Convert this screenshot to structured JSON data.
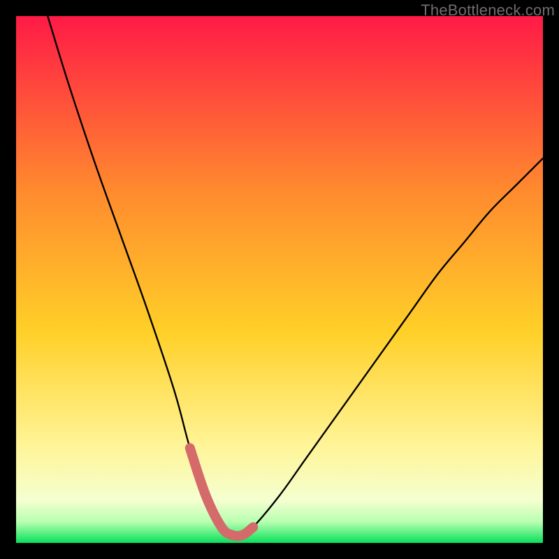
{
  "watermark": "TheBottleneck.com",
  "colors": {
    "bg_black": "#000000",
    "grad_top": "#ff1a46",
    "grad_mid1": "#ff6a2e",
    "grad_mid2": "#ffd028",
    "grad_low": "#fff59a",
    "grad_pale": "#f7ffd6",
    "grad_bottom": "#08e05a",
    "curve": "#000000",
    "highlight": "#d56a6a"
  },
  "chart_data": {
    "type": "line",
    "title": "",
    "xlabel": "",
    "ylabel": "",
    "xlim": [
      0,
      100
    ],
    "ylim": [
      0,
      100
    ],
    "series": [
      {
        "name": "bottleneck-curve",
        "x": [
          6,
          10,
          15,
          20,
          25,
          30,
          33,
          36,
          39,
          41,
          43,
          45,
          50,
          55,
          60,
          65,
          70,
          75,
          80,
          85,
          90,
          95,
          100
        ],
        "y": [
          100,
          87,
          72,
          58,
          44,
          29,
          18,
          9,
          3,
          1.5,
          1.5,
          3,
          9,
          16,
          23,
          30,
          37,
          44,
          51,
          57,
          63,
          68,
          73
        ]
      },
      {
        "name": "optimal-range-highlight",
        "x": [
          33,
          36,
          39,
          41,
          43,
          45
        ],
        "y": [
          18,
          9,
          3,
          1.5,
          1.5,
          3
        ]
      }
    ],
    "gradient_bands": [
      {
        "y_from": 100,
        "y_to": 70,
        "color_from": "#ff1a46",
        "color_to": "#ff6a2e"
      },
      {
        "y_from": 70,
        "y_to": 40,
        "color_from": "#ff6a2e",
        "color_to": "#ffd028"
      },
      {
        "y_from": 40,
        "y_to": 15,
        "color_from": "#ffd028",
        "color_to": "#fff59a"
      },
      {
        "y_from": 15,
        "y_to": 6,
        "color_from": "#fff59a",
        "color_to": "#f7ffd6"
      },
      {
        "y_from": 6,
        "y_to": 0,
        "color_from": "#f7ffd6",
        "color_to": "#08e05a"
      }
    ]
  }
}
